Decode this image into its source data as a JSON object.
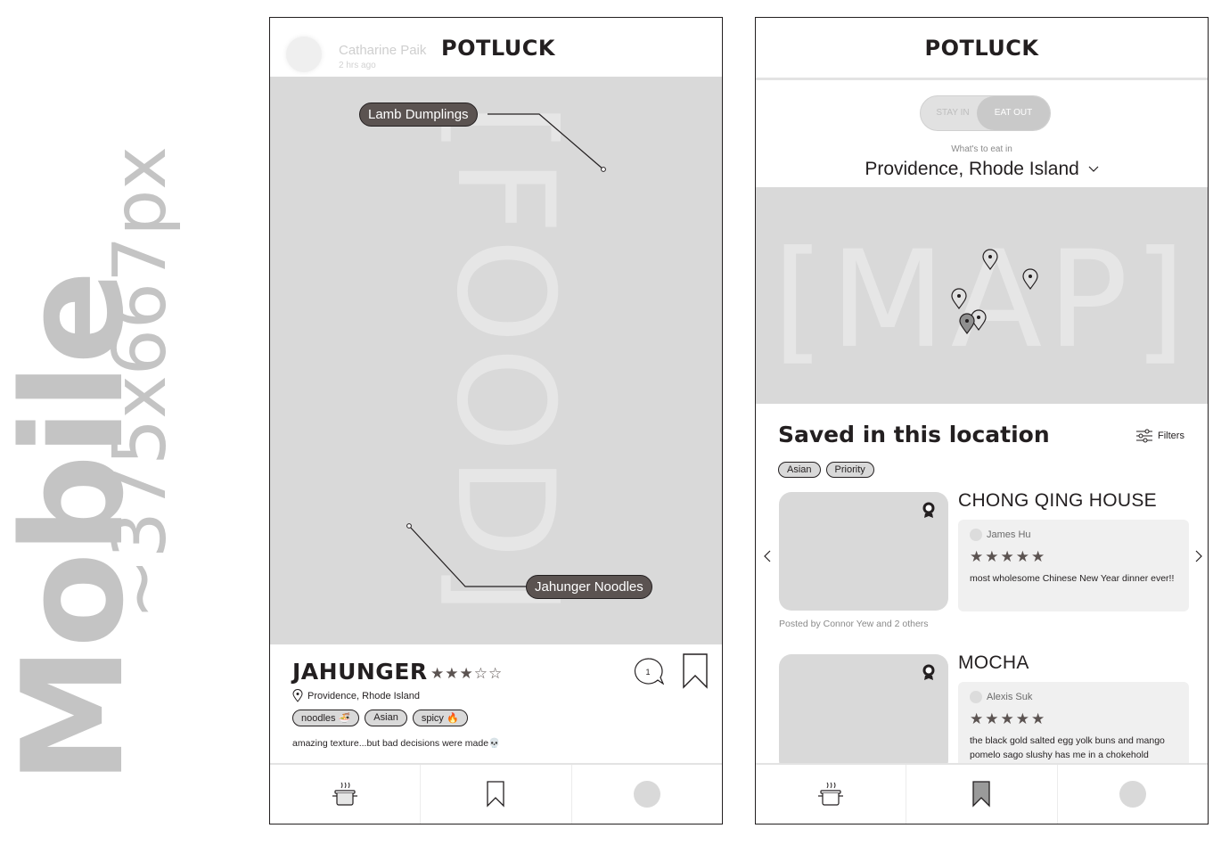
{
  "side_label": {
    "title": "Mobile",
    "size": "~375x667px"
  },
  "left_phone": {
    "poster_name": "Catharine Paik",
    "poster_time": "2 hrs ago",
    "brand": "POTLUCK",
    "food_watermark": "[FOOD]",
    "tags": {
      "dish_1": "Lamb Dumplings",
      "dish_2": "Jahunger Noodles"
    },
    "restaurant": "JAHUNGER",
    "rating_stars": "★★★☆☆",
    "rating": 3,
    "rating_max": 5,
    "location": "Providence, Rhode Island",
    "chips": [
      "noodles 🍜",
      "Asian",
      "spicy 🔥"
    ],
    "caption": "amazing texture...but bad decisions were made💀",
    "comment_count": "1"
  },
  "right_phone": {
    "brand": "POTLUCK",
    "toggle": {
      "off": "STAY IN",
      "on": "EAT OUT"
    },
    "eat_label": "What's to eat in",
    "city": "Providence, Rhode Island",
    "map_watermark": "[MAP]",
    "saved_title": "Saved in this location",
    "filters_label": "Filters",
    "chips": [
      "Asian",
      "Priority"
    ],
    "cards": [
      {
        "title": "CHONG QING HOUSE",
        "reviewer": "James Hu",
        "stars": "★★★★★",
        "rating": 5,
        "review": "most wholesome Chinese New Year dinner ever!!",
        "posted_by": "Posted by Connor Yew and 2 others"
      },
      {
        "title": "MOCHA",
        "reviewer": "Alexis Suk",
        "stars": "★★★★★",
        "rating": 5,
        "review": "the black gold salted egg yolk buns and mango pomelo sago slushy has me in a chokehold"
      }
    ]
  },
  "tabs": {
    "home": "pot-icon",
    "saved": "bookmark-icon",
    "profile": "avatar"
  }
}
